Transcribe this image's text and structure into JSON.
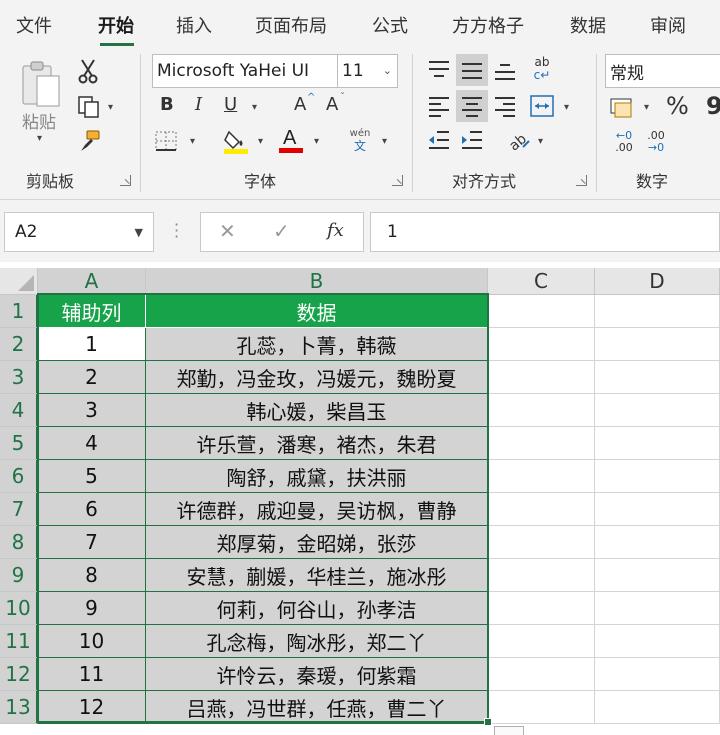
{
  "tabs": [
    "文件",
    "开始",
    "插入",
    "页面布局",
    "公式",
    "方方格子",
    "数据",
    "审阅"
  ],
  "active_tab": "开始",
  "ribbon": {
    "clipboard": {
      "paste_label": "粘贴",
      "group_label": "剪贴板"
    },
    "font": {
      "font_name": "Microsoft YaHei UI",
      "font_size": "11",
      "bold": "B",
      "italic": "I",
      "underline": "U",
      "grow": "A",
      "shrink": "A",
      "phonetic": "wén\n文",
      "group_label": "字体",
      "fill_color": "#ffeb00",
      "font_color": "#e00000"
    },
    "alignment": {
      "group_label": "对齐方式"
    },
    "number": {
      "format": "常规",
      "percent": "%",
      "comma": "9",
      "group_label": "数字"
    }
  },
  "formula_bar": {
    "name_box": "A2",
    "fx": "fx",
    "value": "1"
  },
  "columns": [
    "A",
    "B",
    "C",
    "D"
  ],
  "rows": [
    "1",
    "2",
    "3",
    "4",
    "5",
    "6",
    "7",
    "8",
    "9",
    "10",
    "11",
    "12",
    "13"
  ],
  "table": {
    "headers": [
      "辅助列",
      "数据"
    ],
    "rows": [
      [
        "1",
        "孔蕊，卜菁，韩薇"
      ],
      [
        "2",
        "郑勤，冯金玫，冯媛元，魏盼夏"
      ],
      [
        "3",
        "韩心媛，柴昌玉"
      ],
      [
        "4",
        "许乐萱，潘寒，褚杰，朱君"
      ],
      [
        "5",
        "陶舒，戚黛，扶洪丽"
      ],
      [
        "6",
        "许德群，戚迎曼，吴访枫，曹静"
      ],
      [
        "7",
        "郑厚菊，金昭娣，张莎"
      ],
      [
        "8",
        "安慧，蒯媛，华桂兰，施冰彤"
      ],
      [
        "9",
        "何莉，何谷山，孙孝洁"
      ],
      [
        "10",
        "孔念梅，陶冰彤，郑二丫"
      ],
      [
        "11",
        "许怜云，秦瑷，何紫霜"
      ],
      [
        "12",
        "吕燕，冯世群，任燕，曹二丫"
      ]
    ]
  },
  "colors": {
    "accent": "#217346",
    "header_fill": "#16a34a",
    "data_fill": "#d3d3d3"
  }
}
